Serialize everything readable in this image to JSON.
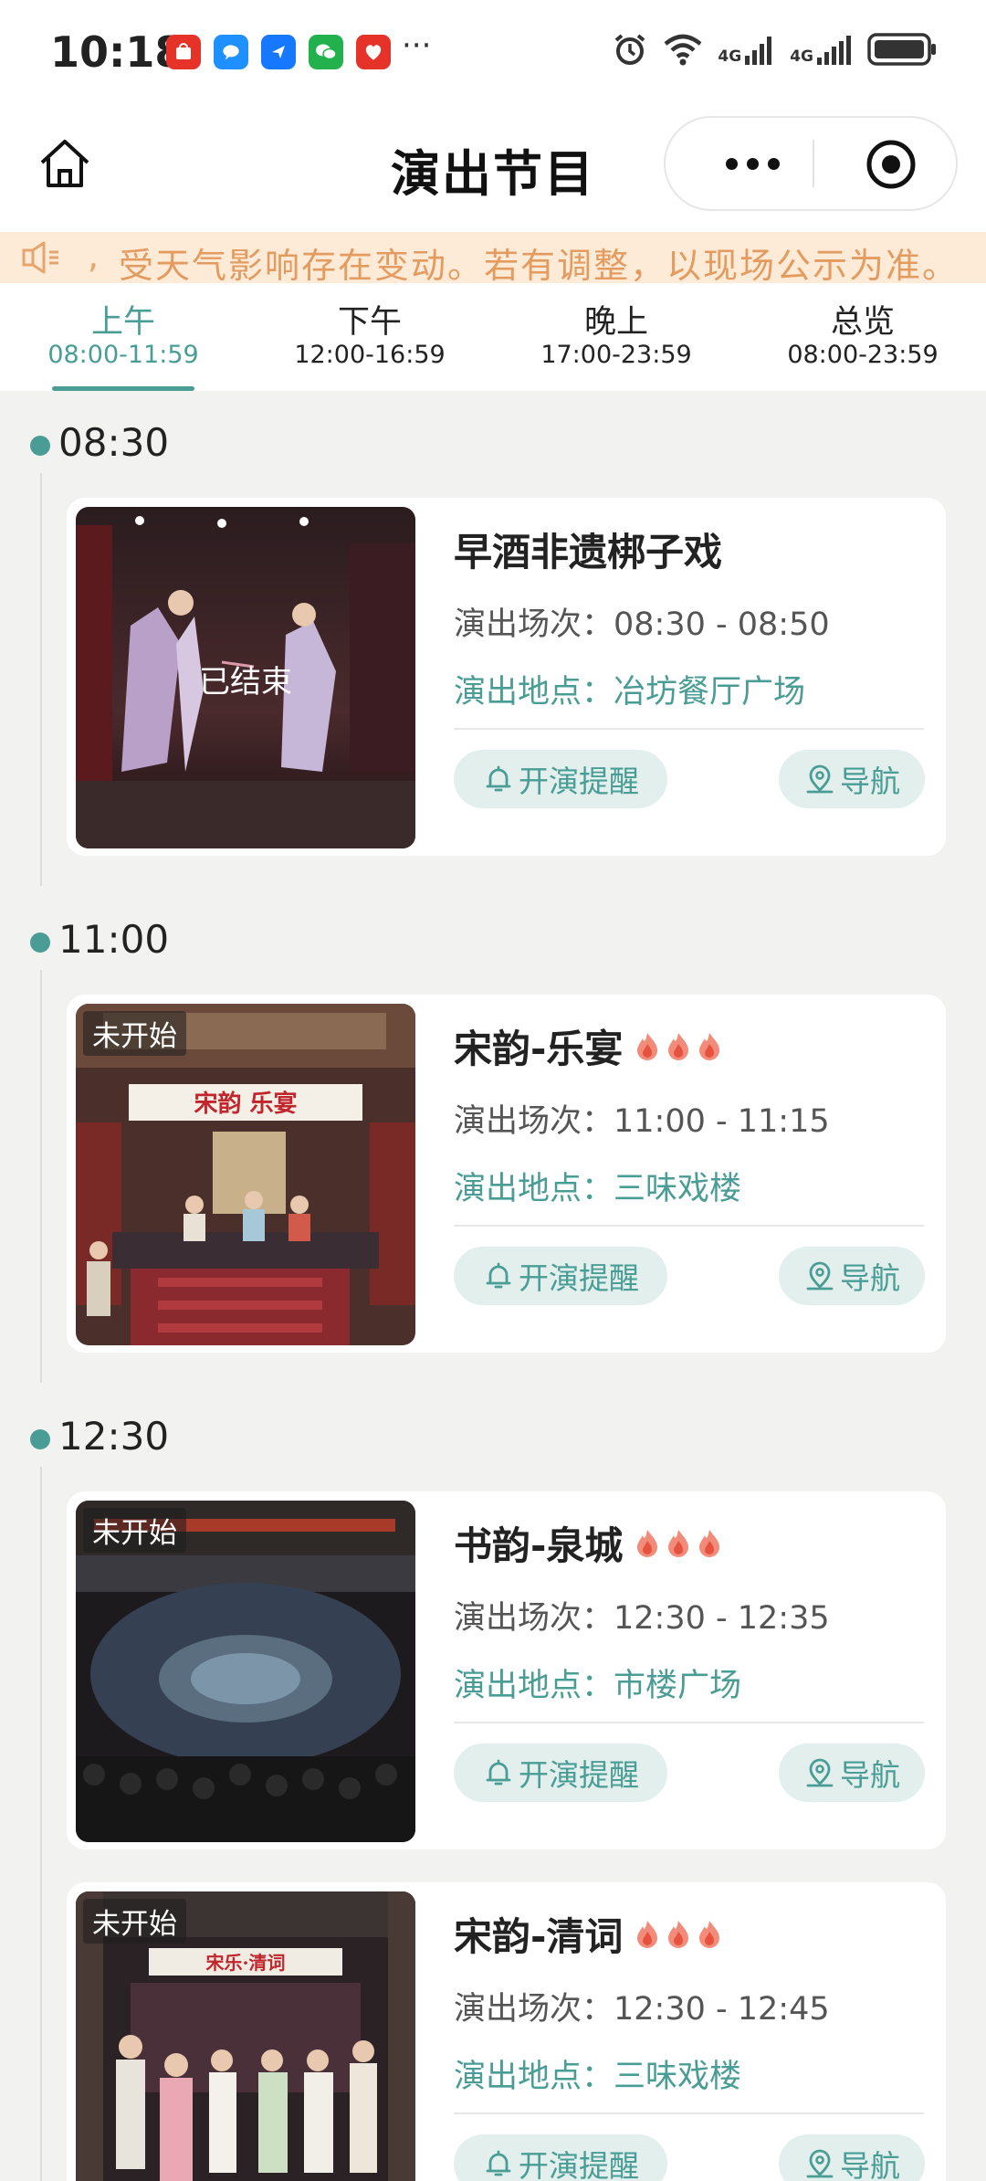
{
  "status_bar": {
    "time": "10:18",
    "more": "···",
    "net1": "4G",
    "net2": "4G",
    "apps": [
      "huawei-store-icon",
      "messages-icon",
      "navigation-app-icon",
      "wechat-icon",
      "fortune-app-icon"
    ]
  },
  "header": {
    "title": "演出节目"
  },
  "notice": {
    "text": "受天气影响存在变动。若有调整，以现场公示为准。"
  },
  "tabs": [
    {
      "label": "上午",
      "time": "08:00-11:59",
      "active": true
    },
    {
      "label": "下午",
      "time": "12:00-16:59",
      "active": false
    },
    {
      "label": "晚上",
      "time": "17:00-23:59",
      "active": false
    },
    {
      "label": "总览",
      "time": "08:00-23:59",
      "active": false
    }
  ],
  "groups": [
    {
      "time": "08:30",
      "show": {
        "title": "早酒非遗梆子戏",
        "hot": false,
        "status": "已结束",
        "session": "演出场次：08:30 - 08:50",
        "venue": "演出地点：冶坊餐厅广场"
      }
    },
    {
      "time": "11:00",
      "show": {
        "title": "宋韵-乐宴",
        "hot": true,
        "status": "未开始",
        "session": "演出场次：11:00 - 11:15",
        "venue": "演出地点：三味戏楼",
        "sign": "宋韵 乐宴"
      }
    },
    {
      "time": "12:30",
      "show": {
        "title": "书韵-泉城",
        "hot": true,
        "status": "未开始",
        "session": "演出场次：12:30 - 12:35",
        "venue": "演出地点：市楼广场"
      }
    },
    {
      "time": "",
      "show": {
        "title": "宋韵-清词",
        "hot": true,
        "status": "未开始",
        "session": "演出场次：12:30 - 12:45",
        "venue": "演出地点：三味戏楼",
        "sign": "宋乐·清词"
      }
    }
  ],
  "buttons": {
    "remind": "开演提醒",
    "navigate": "导航"
  },
  "colors": {
    "accent": "#4a9d95",
    "notice_bg": "#fdebd8",
    "notice_text": "#e39b5f",
    "page_bg": "#f2f3f1"
  }
}
